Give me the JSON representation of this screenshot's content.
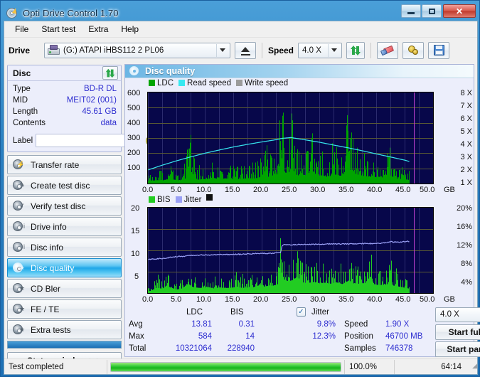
{
  "window": {
    "title": "Opti Drive Control 1.70",
    "icon": "disc-lightning-icon",
    "minimize": "minimize",
    "maximize": "maximize",
    "close": "✕"
  },
  "menu": {
    "items": [
      "File",
      "Start test",
      "Extra",
      "Help"
    ]
  },
  "toolbar": {
    "drive_label": "Drive",
    "drive_value": "(G:)   ATAPI iHBS112   2 PL06",
    "eject_icon": "eject-icon",
    "speed_label": "Speed",
    "speed_value": "4.0 X",
    "refresh_icon": "swap-arrows-icon",
    "eraser_icon": "eraser-icon",
    "settings_icon": "gear-icon",
    "save_icon": "floppy-save-icon"
  },
  "disc": {
    "title": "Disc",
    "refresh_icon": "swap-arrows-icon",
    "rows": [
      {
        "key": "Type",
        "value": "BD-R DL"
      },
      {
        "key": "MID",
        "value": "MEIT02 (001)"
      },
      {
        "key": "Length",
        "value": "45.61 GB"
      },
      {
        "key": "Contents",
        "value": "data"
      }
    ],
    "label_key": "Label",
    "label_value": "",
    "label_placeholder": "",
    "cd_icon": "compact-disc-icon"
  },
  "nav": {
    "items": [
      {
        "id": "transfer-rate",
        "label": "Transfer rate",
        "active": false
      },
      {
        "id": "create-test-disc",
        "label": "Create test disc",
        "active": false
      },
      {
        "id": "verify-test-disc",
        "label": "Verify test disc",
        "active": false
      },
      {
        "id": "drive-info",
        "label": "Drive info",
        "active": false
      },
      {
        "id": "disc-info",
        "label": "Disc info",
        "active": false
      },
      {
        "id": "disc-quality",
        "label": "Disc quality",
        "active": true
      },
      {
        "id": "cd-bler",
        "label": "CD Bler",
        "active": false
      },
      {
        "id": "fe-te",
        "label": "FE / TE",
        "active": false
      },
      {
        "id": "extra-tests",
        "label": "Extra tests",
        "active": false
      }
    ],
    "status_window": "Status window > >"
  },
  "panel": {
    "title": "Disc quality",
    "icon": "disc-quality-icon"
  },
  "stats": {
    "col_headers": [
      "LDC",
      "BIS"
    ],
    "jitter_label": "Jitter",
    "jitter_checked": true,
    "rows": [
      {
        "name": "Avg",
        "ldc": "13.81",
        "bis": "0.31",
        "jitter": "9.8%"
      },
      {
        "name": "Max",
        "ldc": "584",
        "bis": "14",
        "jitter": "12.3%"
      },
      {
        "name": "Total",
        "ldc": "10321064",
        "bis": "228940",
        "jitter": ""
      }
    ],
    "speed_key": "Speed",
    "speed_value": "1.90 X",
    "position_key": "Position",
    "position_value": "46700 MB",
    "samples_key": "Samples",
    "samples_value": "746378",
    "speed_select": "4.0 X",
    "start_full": "Start full",
    "start_part": "Start part"
  },
  "statusbar": {
    "message": "Test completed",
    "percent": "100.0%",
    "progress_value": 100,
    "time": "64:14"
  },
  "colors": {
    "ldc_green": "#00a400",
    "bis_green": "#22cc22",
    "read_speed_cyan": "#37e8f0",
    "write_speed_gray": "#9b9b9b",
    "jitter_lilac": "#9aa0f5",
    "plot_bg": "#07074a",
    "accent_blue": "#2f2fd0",
    "progress_green": "#16b51b",
    "selection_cyan": "#1fa7e8"
  },
  "chart_data": [
    {
      "type": "area",
      "id": "ldc-chart",
      "title": "",
      "legend": [
        {
          "name": "LDC",
          "color": "#00a400"
        },
        {
          "name": "Read speed",
          "color": "#37e8f0"
        },
        {
          "name": "Write speed",
          "color": "#9b9b9b"
        }
      ],
      "legend_position": "top-left",
      "grid": true,
      "xlabel": "GB",
      "x_ticks": [
        "0.0",
        "5.0",
        "10.0",
        "15.0",
        "20.0",
        "25.0",
        "30.0",
        "35.0",
        "40.0",
        "45.0",
        "50.0"
      ],
      "xlim": [
        0,
        50
      ],
      "ylabel_left": "LDC",
      "y_ticks_left": [
        "100",
        "200",
        "300",
        "400",
        "500",
        "600"
      ],
      "ylim_left": [
        0,
        600
      ],
      "ylabel_right": "Speed",
      "y_ticks_right": [
        "1 X",
        "2 X",
        "3 X",
        "4 X",
        "5 X",
        "6 X",
        "7 X",
        "8 X"
      ],
      "ylim_right": [
        0,
        8
      ],
      "marker_line_x": 46.6,
      "marker_line_color": "#c040d0",
      "series": [
        {
          "name": "Read speed",
          "color": "#37e8f0",
          "axis": "right",
          "x": [
            0.0,
            2.5,
            5.0,
            7.5,
            10.0,
            12.5,
            15.0,
            17.5,
            20.0,
            22.5,
            23.5,
            25.0,
            27.5,
            30.0,
            32.5,
            35.0,
            37.5,
            40.0,
            42.5,
            45.0,
            46.0
          ],
          "y": [
            1.2,
            1.62,
            2.0,
            2.35,
            2.67,
            2.95,
            3.22,
            3.45,
            3.66,
            3.86,
            3.97,
            4.04,
            3.84,
            3.63,
            3.38,
            3.14,
            2.88,
            2.6,
            2.33,
            2.05,
            1.9
          ]
        },
        {
          "name": "LDC",
          "color": "#00a400",
          "axis": "left",
          "note": "scan error bars, avg 13.81, max 584, total 10321064; dense green band rising after 23 GB",
          "x": [
            0.5,
            1.5,
            2.5,
            3.5,
            4.5,
            5.5,
            6.5,
            7.4,
            8.5,
            9.5,
            10.5,
            11.5,
            12.5,
            13.5,
            14.5,
            15.5,
            16.5,
            17.5,
            18.5,
            19.5,
            20.2,
            21.0,
            22.0,
            22.8,
            23.4,
            23.6,
            24.0,
            24.6,
            25.2,
            25.8,
            26.4,
            27.0,
            27.6,
            28.2,
            28.8,
            29.4,
            30.0,
            30.6,
            31.2,
            31.8,
            32.4,
            33.0,
            33.6,
            34.2,
            34.8,
            35.4,
            36.0,
            36.4,
            36.8,
            37.4,
            38.0,
            38.6,
            39.2,
            39.8,
            40.4,
            41.0,
            41.6,
            42.2,
            42.8,
            43.4,
            44.0,
            44.6,
            45.2,
            45.8
          ],
          "y": [
            60,
            75,
            68,
            95,
            85,
            70,
            110,
            290,
            80,
            95,
            105,
            125,
            90,
            115,
            100,
            95,
            105,
            120,
            110,
            130,
            210,
            150,
            165,
            175,
            585,
            435,
            240,
            235,
            370,
            205,
            175,
            195,
            185,
            175,
            290,
            200,
            165,
            185,
            150,
            160,
            185,
            200,
            170,
            180,
            380,
            310,
            250,
            215,
            195,
            175,
            165,
            155,
            150,
            140,
            150,
            135,
            130,
            240,
            120,
            110,
            105,
            95,
            90,
            80
          ]
        }
      ]
    },
    {
      "type": "area",
      "id": "bis-jitter-chart",
      "title": "",
      "legend": [
        {
          "name": "BIS",
          "color": "#22cc22"
        },
        {
          "name": "Jitter",
          "color": "#9aa0f5"
        }
      ],
      "legend_position": "top-left",
      "grid": true,
      "xlabel": "GB",
      "x_ticks": [
        "0.0",
        "5.0",
        "10.0",
        "15.0",
        "20.0",
        "25.0",
        "30.0",
        "35.0",
        "40.0",
        "45.0",
        "50.0"
      ],
      "xlim": [
        0,
        50
      ],
      "ylabel_left": "BIS",
      "y_ticks_left": [
        "5",
        "10",
        "15",
        "20"
      ],
      "ylim_left": [
        0,
        20
      ],
      "ylabel_right": "Jitter",
      "y_ticks_right": [
        "4%",
        "8%",
        "12%",
        "16%",
        "20%"
      ],
      "ylim_right": [
        0,
        20
      ],
      "marker_line_x": 46.6,
      "marker_line_color": "#c040d0",
      "series": [
        {
          "name": "Jitter",
          "color": "#9aa0f5",
          "axis": "right",
          "x": [
            0.2,
            1.5,
            3.0,
            4.5,
            6.0,
            7.5,
            9.0,
            10.5,
            12.0,
            13.5,
            15.0,
            16.5,
            18.0,
            19.5,
            21.0,
            22.5,
            23.2,
            23.5,
            25.0,
            27.0,
            29.0,
            31.0,
            33.0,
            35.0,
            37.0,
            39.0,
            41.0,
            42.5,
            44.0,
            45.5,
            46.0
          ],
          "y": [
            7.9,
            8.0,
            8.2,
            8.5,
            8.6,
            8.8,
            8.9,
            8.9,
            9.0,
            9.0,
            9.1,
            9.1,
            9.2,
            9.3,
            9.3,
            9.4,
            9.5,
            11.3,
            11.3,
            11.4,
            11.4,
            11.5,
            11.5,
            11.5,
            11.6,
            11.6,
            11.7,
            12.0,
            11.9,
            12.1,
            12.1
          ]
        },
        {
          "name": "BIS",
          "color": "#22cc22",
          "axis": "left",
          "note": "avg 0.31, max 14, total 228940; baseline ~1-2 rising to ~4 after 23 GB",
          "x": [
            0.5,
            1.5,
            2.5,
            3.2,
            4.0,
            5.0,
            6.0,
            7.0,
            7.8,
            8.6,
            9.5,
            10.5,
            11.5,
            12.5,
            13.5,
            14.5,
            15.5,
            16.5,
            17.5,
            18.5,
            19.5,
            20.2,
            21.0,
            22.0,
            22.8,
            23.3,
            23.5,
            24.0,
            24.6,
            25.2,
            26.2,
            27.0,
            28.0,
            29.0,
            30.0,
            31.0,
            32.0,
            33.0,
            34.0,
            35.2,
            36.0,
            37.0,
            38.0,
            39.0,
            39.6,
            40.5,
            41.5,
            42.5,
            43.0,
            44.0,
            45.0,
            45.6
          ],
          "y": [
            1.2,
            3.0,
            2.4,
            4.2,
            3.0,
            2.0,
            2.6,
            5.3,
            3.4,
            3.0,
            2.8,
            3.4,
            2.6,
            3.2,
            2.8,
            3.0,
            3.4,
            2.9,
            3.1,
            3.3,
            4.4,
            3.6,
            4.0,
            4.2,
            5.0,
            14.0,
            10.2,
            7.2,
            6.6,
            7.1,
            9.0,
            6.0,
            5.6,
            6.2,
            5.4,
            5.8,
            5.2,
            6.0,
            5.0,
            7.0,
            5.4,
            5.2,
            5.6,
            9.4,
            5.0,
            4.4,
            4.8,
            5.2,
            4.2,
            3.6,
            3.0,
            2.6
          ]
        }
      ]
    }
  ]
}
